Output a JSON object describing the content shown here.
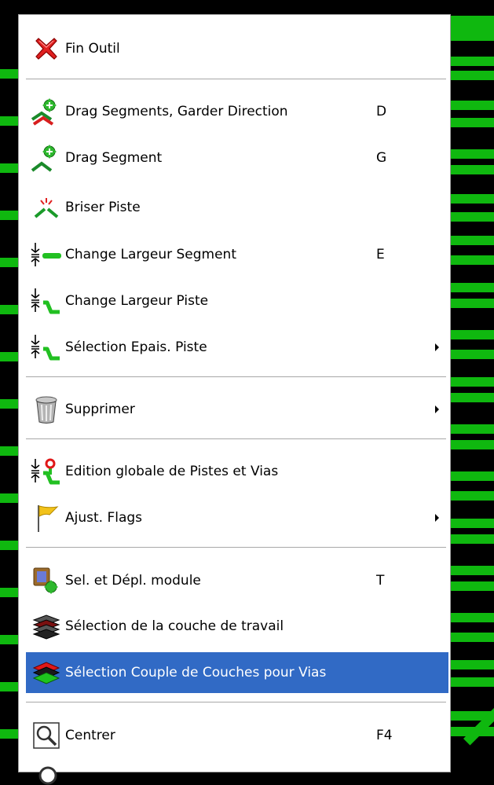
{
  "menu": {
    "items": [
      {
        "label": "Fin Outil",
        "shortcut": "",
        "submenu": false,
        "icon": "red-x-icon"
      },
      {
        "label": "Drag Segments, Garder Direction",
        "shortcut": "D",
        "submenu": false,
        "icon": "drag-segments-keep-direction-icon"
      },
      {
        "label": "Drag Segment",
        "shortcut": "G",
        "submenu": false,
        "icon": "drag-segment-icon"
      },
      {
        "label": "Briser Piste",
        "shortcut": "",
        "submenu": false,
        "icon": "break-track-icon"
      },
      {
        "label": "Change Largeur Segment",
        "shortcut": "E",
        "submenu": false,
        "icon": "segment-width-icon"
      },
      {
        "label": "Change Largeur Piste",
        "shortcut": "",
        "submenu": false,
        "icon": "track-width-icon"
      },
      {
        "label": "Sélection Epais. Piste",
        "shortcut": "",
        "submenu": true,
        "icon": "track-thickness-select-icon"
      },
      {
        "label": "Supprimer",
        "shortcut": "",
        "submenu": true,
        "icon": "trash-can-icon"
      },
      {
        "label": "Edition globale de Pistes et Vias",
        "shortcut": "",
        "submenu": false,
        "icon": "global-edit-tracks-vias-icon"
      },
      {
        "label": "Ajust. Flags",
        "shortcut": "",
        "submenu": true,
        "icon": "flag-icon"
      },
      {
        "label": "Sel. et Dépl. module",
        "shortcut": "T",
        "submenu": false,
        "icon": "select-move-module-icon"
      },
      {
        "label": "Sélection de la couche de travail",
        "shortcut": "",
        "submenu": false,
        "icon": "layers-select-icon"
      },
      {
        "label": "Sélection Couple de Couches pour Vias",
        "shortcut": "",
        "submenu": false,
        "icon": "layer-pair-vias-icon",
        "selected": true
      },
      {
        "label": "Centrer",
        "shortcut": "F4",
        "submenu": false,
        "icon": "zoom-center-icon"
      }
    ]
  },
  "colors": {
    "pcb_green": "#0fb80f",
    "selection_blue": "#316ac5",
    "menu_bg": "#ffffff"
  }
}
